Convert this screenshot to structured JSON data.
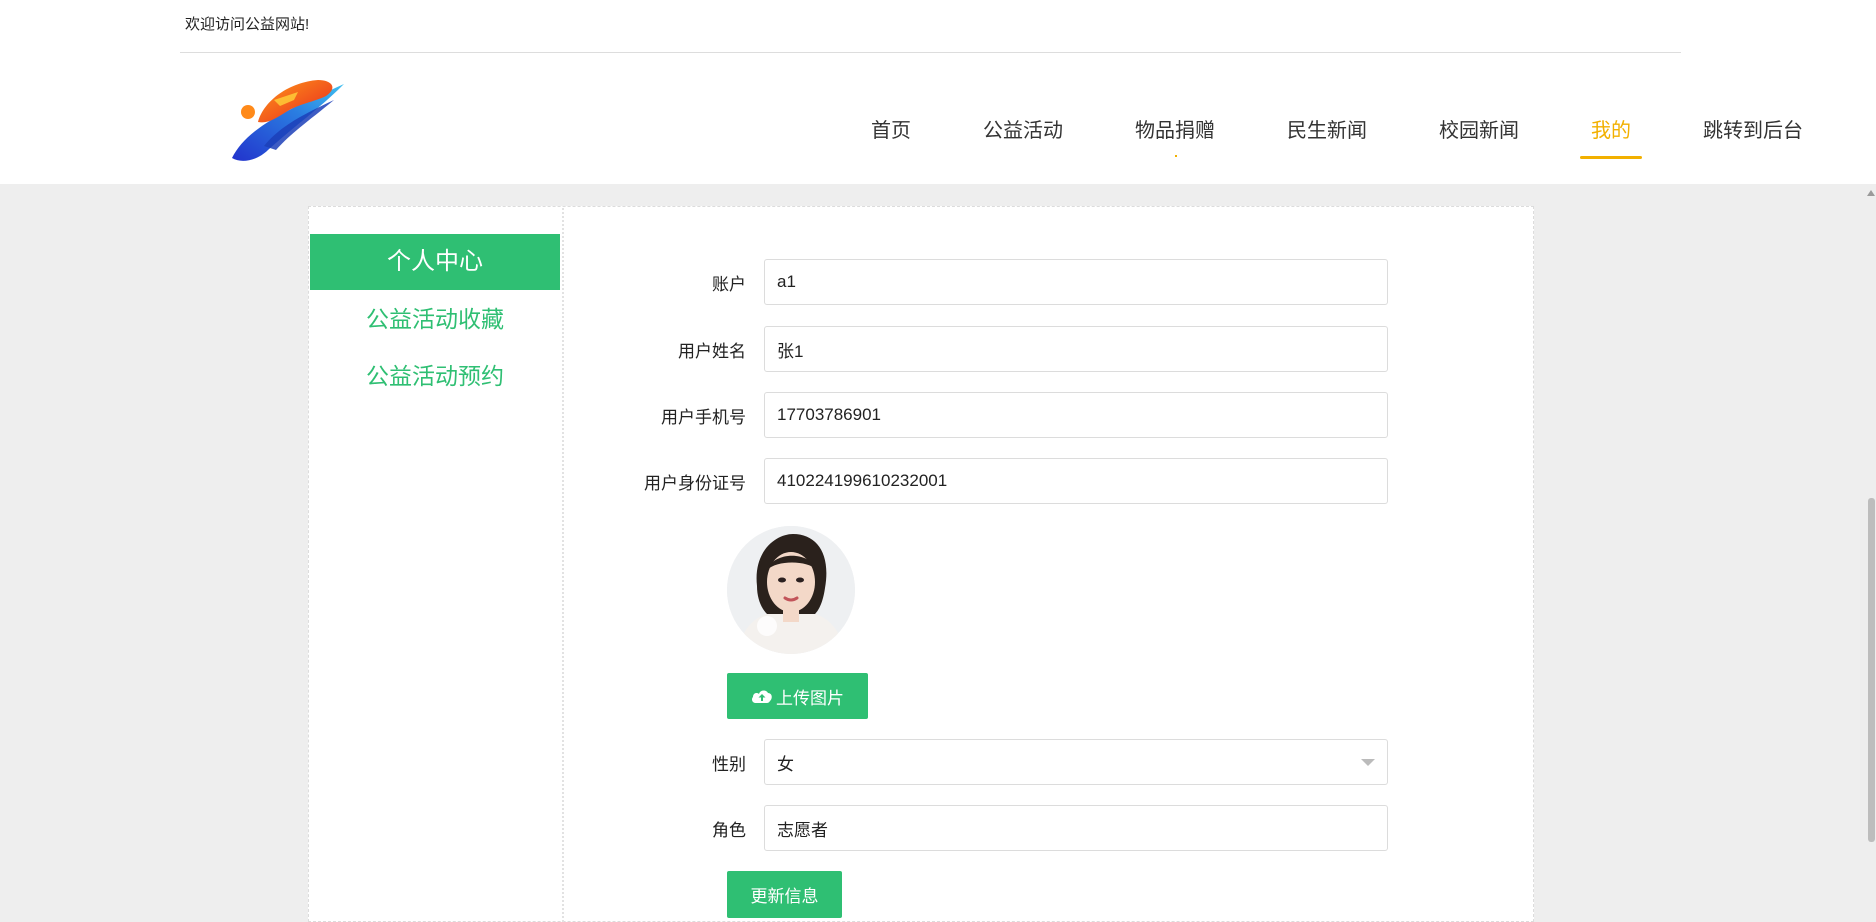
{
  "header": {
    "welcome": "欢迎访问公益网站!",
    "nav": [
      {
        "label": "首页"
      },
      {
        "label": "公益活动"
      },
      {
        "label": "物品捐赠"
      },
      {
        "label": "民生新闻"
      },
      {
        "label": "校园新闻"
      },
      {
        "label": "我的",
        "active": true
      },
      {
        "label": "跳转到后台"
      }
    ]
  },
  "sidebar": {
    "title": "个人中心",
    "links": [
      "公益活动收藏",
      "公益活动预约"
    ]
  },
  "form": {
    "account": {
      "label": "账户",
      "value": "a1"
    },
    "name": {
      "label": "用户姓名",
      "value": "张1"
    },
    "phone": {
      "label": "用户手机号",
      "value": "17703786901"
    },
    "idcard": {
      "label": "用户身份证号",
      "value": "410224199610232001"
    },
    "upload_label": "上传图片",
    "gender": {
      "label": "性别",
      "value": "女"
    },
    "role": {
      "label": "角色",
      "value": "志愿者"
    },
    "submit_label": "更新信息"
  },
  "colors": {
    "accent": "#2fbf73",
    "nav_active": "#f2b000"
  },
  "icons": {
    "upload": "cloud-upload-icon",
    "select": "chevron-down-icon"
  }
}
